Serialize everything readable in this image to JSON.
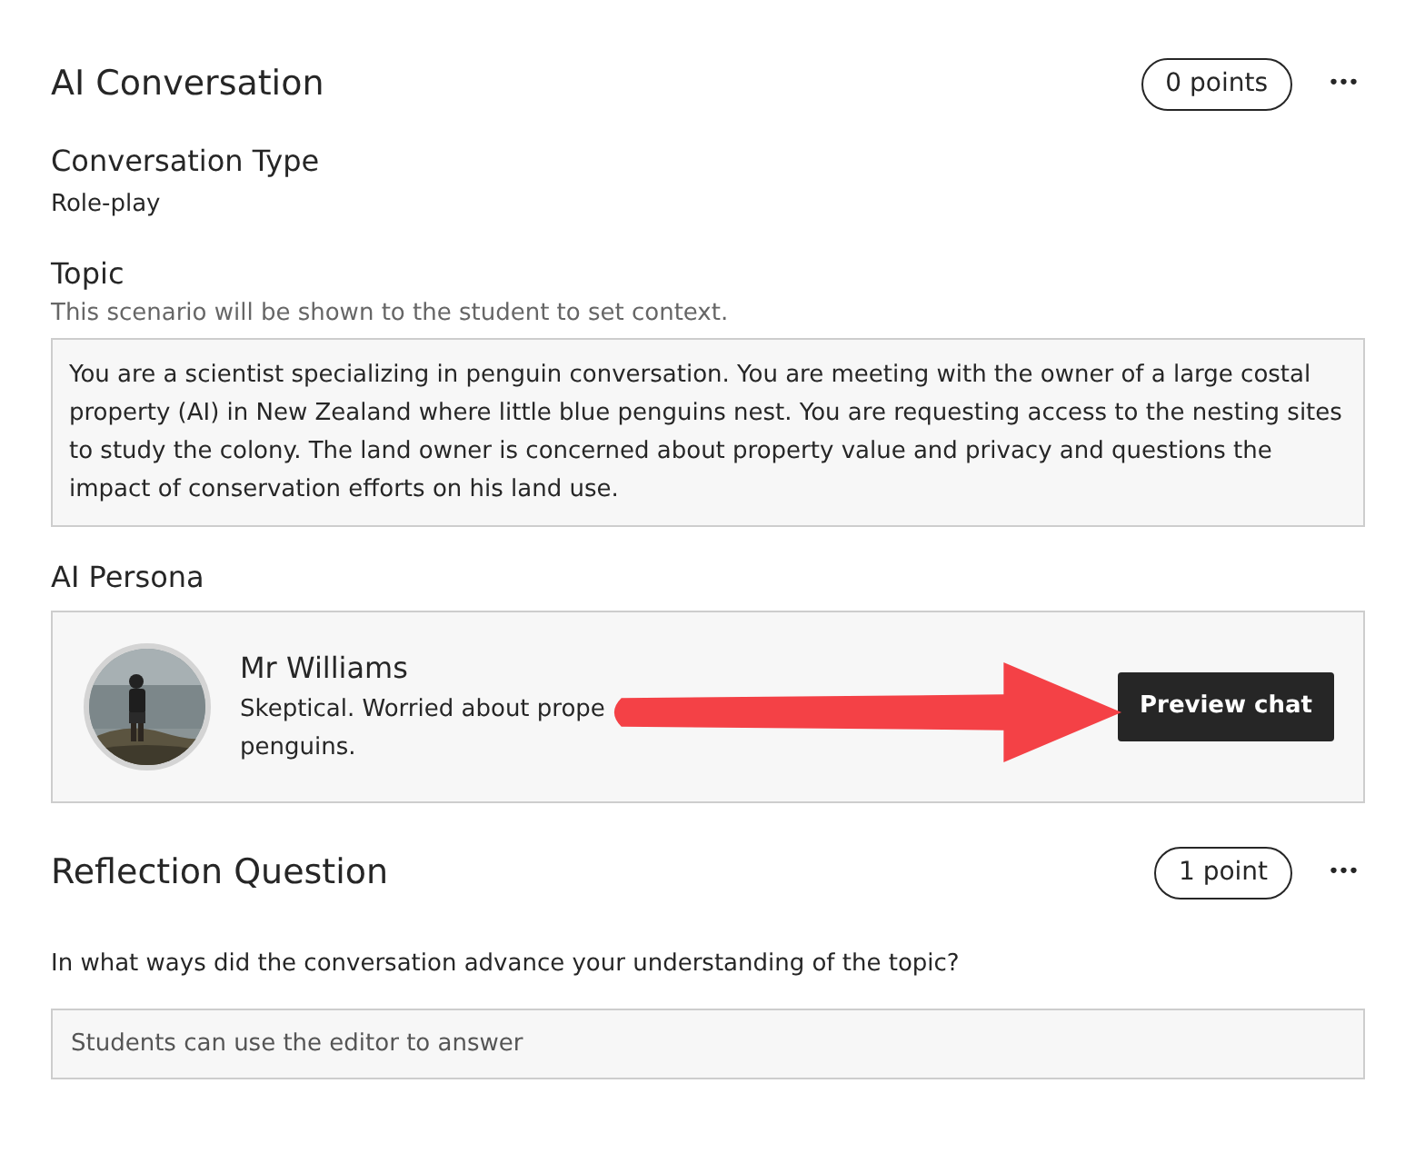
{
  "conversation": {
    "title": "AI Conversation",
    "points": "0 points",
    "more": "•••"
  },
  "type": {
    "label": "Conversation Type",
    "value": "Role-play"
  },
  "topic": {
    "label": "Topic",
    "hint": "This scenario will be shown to the student to set context.",
    "text": "You are a scientist specializing in penguin conversation. You are meeting with the owner of a large costal property (AI) in New Zealand where little blue penguins nest. You are requesting access to the nesting sites to study the colony. The land owner is concerned about property value and privacy and questions the impact of conservation efforts on his land use."
  },
  "persona": {
    "label": "AI Persona",
    "name": "Mr Williams",
    "description_lines": [
      "Skeptical. Worried about prope",
      "penguins."
    ],
    "button": "Preview chat"
  },
  "reflection": {
    "title": "Reflection Question",
    "points": "1 point",
    "more": "•••",
    "question": "In what ways did the conversation advance your understanding of the topic?",
    "placeholder": "Students can use the editor to answer"
  }
}
